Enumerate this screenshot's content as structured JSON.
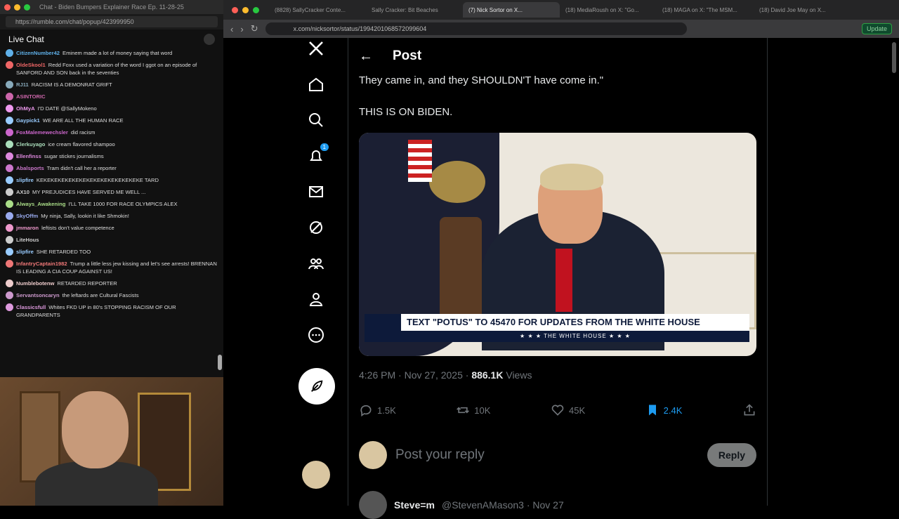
{
  "left_window": {
    "title": "Chat - Biden Bumpers Explainer Race Ep. 11-28-25",
    "url": "https://rumble.com/chat/popup/423999950",
    "chat_title": "Live Chat",
    "messages": [
      {
        "user": "CitizenNumber42",
        "text": "Eminem made a lot of money saying that word",
        "color": "#5fb0e8"
      },
      {
        "user": "OldeSkool1",
        "text": "Redd Foxx used a variation of the word I ggot on an episode of SANFORD AND SON back in the seventies",
        "color": "#e66"
      },
      {
        "user": "RJ11",
        "text": "RACISM IS A DEMONRAT GRIFT",
        "color": "#8ab"
      },
      {
        "user": "ASINTORIC",
        "text": "",
        "color": "#c6a"
      },
      {
        "user": "OhMyA",
        "text": "I'D DATE @SallyMokeno",
        "color": "#e9e"
      },
      {
        "user": "Gaypick1",
        "text": "WE ARE ALL THE HUMAN RACE",
        "color": "#9cf"
      },
      {
        "user": "FoxMalemewechsler",
        "text": "did racism",
        "color": "#c6c"
      },
      {
        "user": "Clerkuyago",
        "text": "ice cream flavored shampoo",
        "color": "#adb"
      },
      {
        "user": "Ellenfinss",
        "text": "sugar stickes journalisms",
        "color": "#d8d"
      },
      {
        "user": "Abalsports",
        "text": "Tram didn't call her a reporter",
        "color": "#c7c"
      },
      {
        "user": "slipfire",
        "text": "KEKEKEKEKEKEKEKEKEKEKEKEKEKEKE TARD",
        "color": "#9cf"
      },
      {
        "user": "AX10",
        "text": "MY PREJUDICES HAVE SERVED ME WELL ...",
        "color": "#ccc"
      },
      {
        "user": "Always_Awakening",
        "text": "I'LL TAKE 1000 FOR RACE OLYMPICS ALEX",
        "color": "#ad8"
      },
      {
        "user": "SkyOffm",
        "text": "My ninja, Sally, lookin it like Shmokin!",
        "color": "#9ae"
      },
      {
        "user": "jmmaron",
        "text": "leftists don't value competence",
        "color": "#e9c"
      },
      {
        "user": "LiteHous",
        "text": "",
        "color": "#ccc"
      },
      {
        "user": "slipfire",
        "text": "SHE RETARDED TOO",
        "color": "#9cf"
      },
      {
        "user": "InfantryCaptain1982",
        "text": "Trump a little less jew kissing and let's see arrests! BRENNAN IS LEADING A CIA COUP AGAINST US!",
        "color": "#e77"
      },
      {
        "user": "Numblebotenw",
        "text": "RETARDED REPORTER",
        "color": "#ecc"
      },
      {
        "user": "Servantsoncaryn",
        "text": "the leftards are Cultural Fascists",
        "color": "#c9c"
      },
      {
        "user": "Classicsfull",
        "text": "Whites FKD UP in 80's STOPPING RACISM OF OUR GRANDPARENTS",
        "color": "#d9d"
      }
    ]
  },
  "browser": {
    "tabs": [
      {
        "label": "(8828) SallyCracker Conte..."
      },
      {
        "label": "Sally Cracker: Bit Beaches"
      },
      {
        "label": "(7) Nick Sortor on X..."
      },
      {
        "label": "(18) MediaRoush on X: \"Go..."
      },
      {
        "label": "(18) MAGA on X: \"The MSM..."
      },
      {
        "label": "(18) David Joe May on X..."
      }
    ],
    "url": "x.com/nicksortor/status/1994201068572099604",
    "update_label": "Update"
  },
  "post": {
    "header": "Post",
    "line1": "They came in, and they SHOULDN'T have come in.\"",
    "line2": "THIS IS ON BIDEN.",
    "chyron": "TEXT \"POTUS\" TO 45470 FOR UPDATES FROM THE WHITE HOUSE",
    "chyron_sub": "★ ★ ★  THE WHITE HOUSE  ★ ★ ★",
    "time": "4:26 PM · Nov 27, 2025 ·",
    "views_count": "886.1K",
    "views_label": "Views",
    "replies": "1.5K",
    "reposts": "10K",
    "likes": "45K",
    "bookmarks": "2.4K",
    "reply_placeholder": "Post your reply",
    "reply_button": "Reply",
    "next_user": "Steve=m",
    "next_handle": "@StevenAMason3 · Nov 27"
  },
  "nav": {
    "notification_count": "1"
  }
}
